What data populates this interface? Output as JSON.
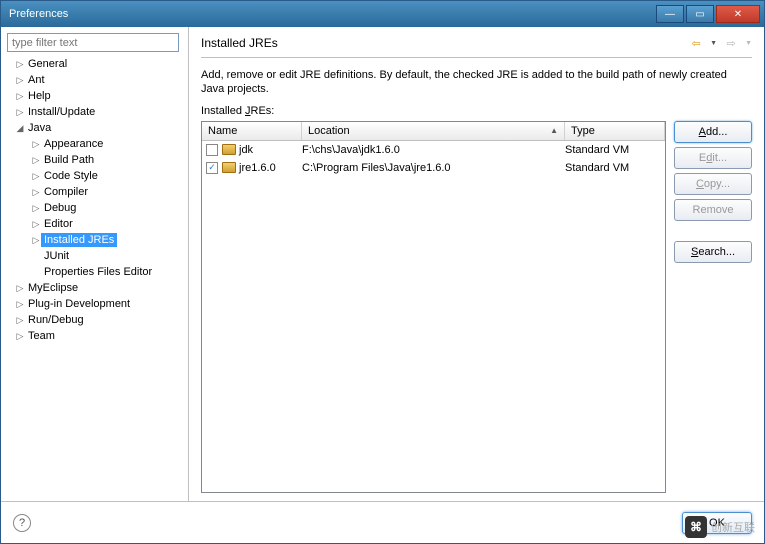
{
  "window": {
    "title": "Preferences"
  },
  "filter": {
    "placeholder": "type filter text"
  },
  "tree": {
    "items": [
      {
        "label": "General",
        "level": 1,
        "expander": "▷",
        "selected": false
      },
      {
        "label": "Ant",
        "level": 1,
        "expander": "▷",
        "selected": false
      },
      {
        "label": "Help",
        "level": 1,
        "expander": "▷",
        "selected": false
      },
      {
        "label": "Install/Update",
        "level": 1,
        "expander": "▷",
        "selected": false
      },
      {
        "label": "Java",
        "level": 1,
        "expander": "◢",
        "selected": false
      },
      {
        "label": "Appearance",
        "level": 2,
        "expander": "▷",
        "selected": false
      },
      {
        "label": "Build Path",
        "level": 2,
        "expander": "▷",
        "selected": false
      },
      {
        "label": "Code Style",
        "level": 2,
        "expander": "▷",
        "selected": false
      },
      {
        "label": "Compiler",
        "level": 2,
        "expander": "▷",
        "selected": false
      },
      {
        "label": "Debug",
        "level": 2,
        "expander": "▷",
        "selected": false
      },
      {
        "label": "Editor",
        "level": 2,
        "expander": "▷",
        "selected": false
      },
      {
        "label": "Installed JREs",
        "level": 2,
        "expander": "▷",
        "selected": true
      },
      {
        "label": "JUnit",
        "level": 2,
        "expander": "",
        "selected": false
      },
      {
        "label": "Properties Files Editor",
        "level": 2,
        "expander": "",
        "selected": false
      },
      {
        "label": "MyEclipse",
        "level": 1,
        "expander": "▷",
        "selected": false
      },
      {
        "label": "Plug-in Development",
        "level": 1,
        "expander": "▷",
        "selected": false
      },
      {
        "label": "Run/Debug",
        "level": 1,
        "expander": "▷",
        "selected": false
      },
      {
        "label": "Team",
        "level": 1,
        "expander": "▷",
        "selected": false
      }
    ]
  },
  "main": {
    "title": "Installed JREs",
    "description": "Add, remove or edit JRE definitions. By default, the checked JRE is added to the build path of newly created Java projects.",
    "list_label_prefix": "Installed ",
    "list_label_key": "J",
    "list_label_suffix": "REs:",
    "columns": {
      "name": "Name",
      "location": "Location",
      "type": "Type"
    },
    "rows": [
      {
        "checked": false,
        "name": "jdk",
        "location": "F:\\chs\\Java\\jdk1.6.0",
        "type": "Standard VM"
      },
      {
        "checked": true,
        "name": "jre1.6.0",
        "location": "C:\\Program Files\\Java\\jre1.6.0",
        "type": "Standard VM"
      }
    ],
    "buttons": {
      "add_key": "A",
      "add_suffix": "dd...",
      "edit_prefix": "E",
      "edit_key": "d",
      "edit_suffix": "it...",
      "copy_key": "C",
      "copy_suffix": "opy...",
      "remove": "Remove",
      "search_key": "S",
      "search_suffix": "earch..."
    }
  },
  "footer": {
    "ok": "OK"
  },
  "watermark": {
    "text": "创新互联"
  }
}
